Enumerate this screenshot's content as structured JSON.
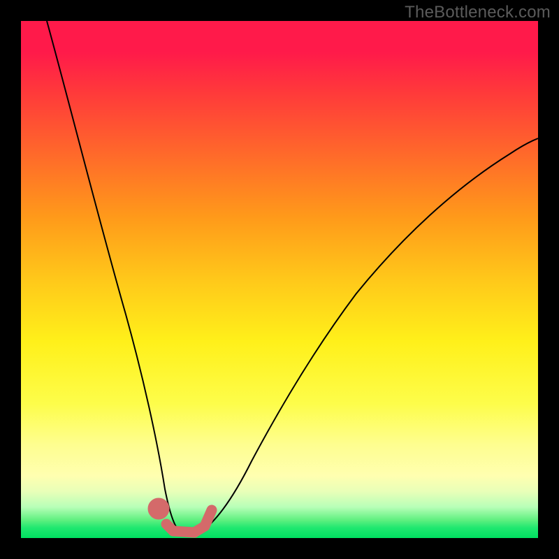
{
  "watermark": "TheBottleneck.com",
  "chart_data": {
    "type": "line",
    "title": "",
    "xlabel": "",
    "ylabel": "",
    "axis_visible": false,
    "background": {
      "type": "vertical-gradient",
      "stops": [
        {
          "pos": 0.0,
          "color": "#ff1a4a"
        },
        {
          "pos": 0.5,
          "color": "#ffc81a"
        },
        {
          "pos": 0.82,
          "color": "#fefe90"
        },
        {
          "pos": 0.96,
          "color": "#60f080"
        },
        {
          "pos": 1.0,
          "color": "#00e060"
        }
      ]
    },
    "xlim": [
      0,
      1
    ],
    "ylim": [
      0,
      1
    ],
    "series": [
      {
        "name": "bottleneck-curve",
        "color": "#000000",
        "width": 2,
        "x": [
          0.05,
          0.1,
          0.15,
          0.2,
          0.24,
          0.27,
          0.29,
          0.31,
          0.33,
          0.36,
          0.4,
          0.45,
          0.5,
          0.56,
          0.64,
          0.74,
          0.86,
          1.0
        ],
        "y": [
          1.0,
          0.81,
          0.62,
          0.42,
          0.24,
          0.1,
          0.03,
          0.01,
          0.01,
          0.03,
          0.09,
          0.19,
          0.3,
          0.41,
          0.52,
          0.62,
          0.7,
          0.76
        ]
      }
    ],
    "markers": {
      "name": "valley-highlight",
      "color": "#d46a6a",
      "shape": "round-capsule",
      "x": [
        0.265,
        0.282,
        0.3,
        0.32,
        0.345,
        0.358
      ],
      "y": [
        0.045,
        0.018,
        0.01,
        0.012,
        0.022,
        0.05
      ]
    }
  }
}
